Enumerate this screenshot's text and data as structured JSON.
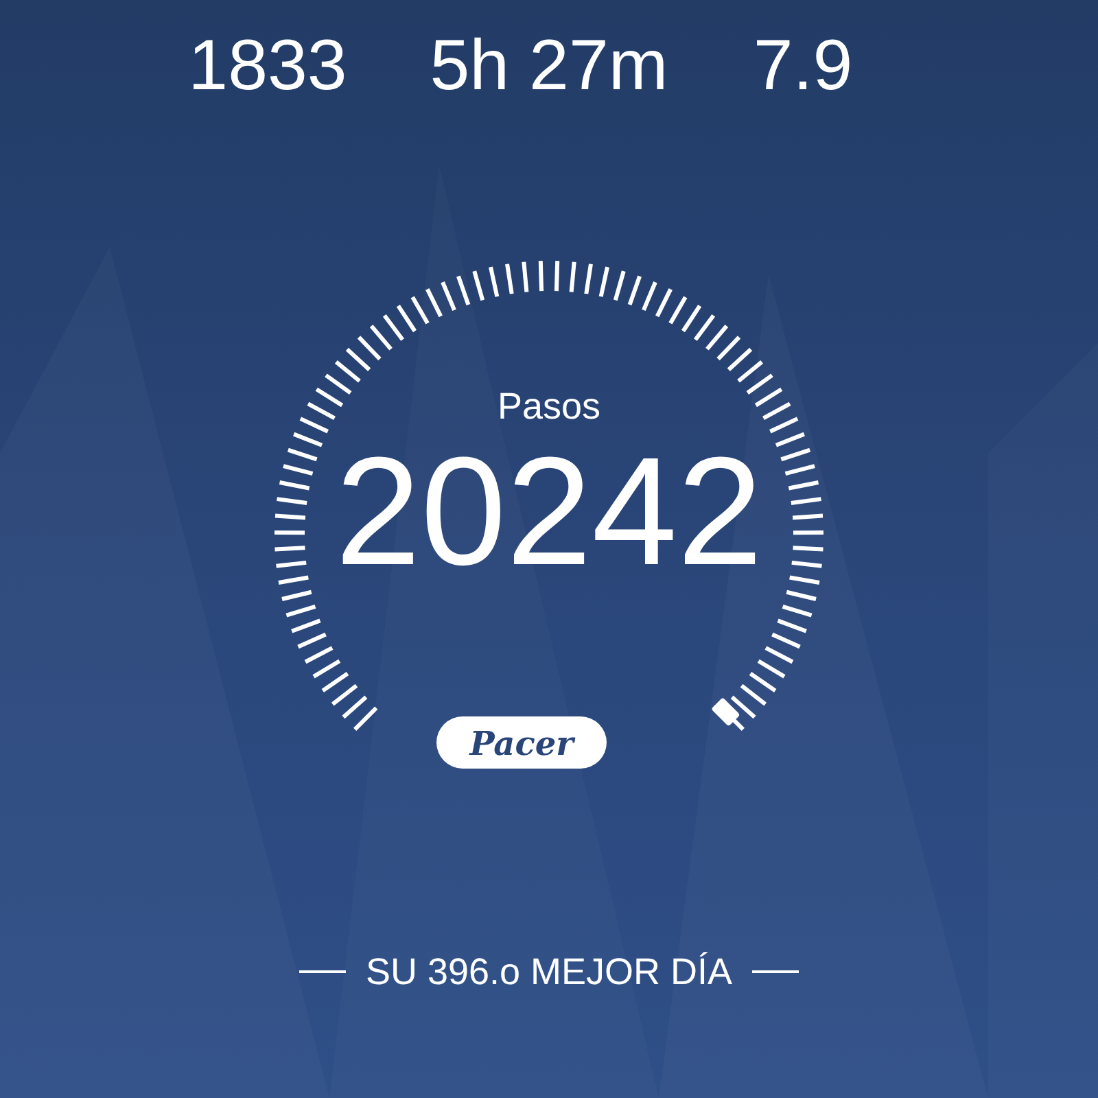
{
  "stats": [
    {
      "value": "1833"
    },
    {
      "value": "5h 27m"
    },
    {
      "value": "7.9"
    }
  ],
  "gauge": {
    "label": "Pasos",
    "value": "20242"
  },
  "badge": "Pacer",
  "footer": "SU 396.o MEJOR DÍA"
}
